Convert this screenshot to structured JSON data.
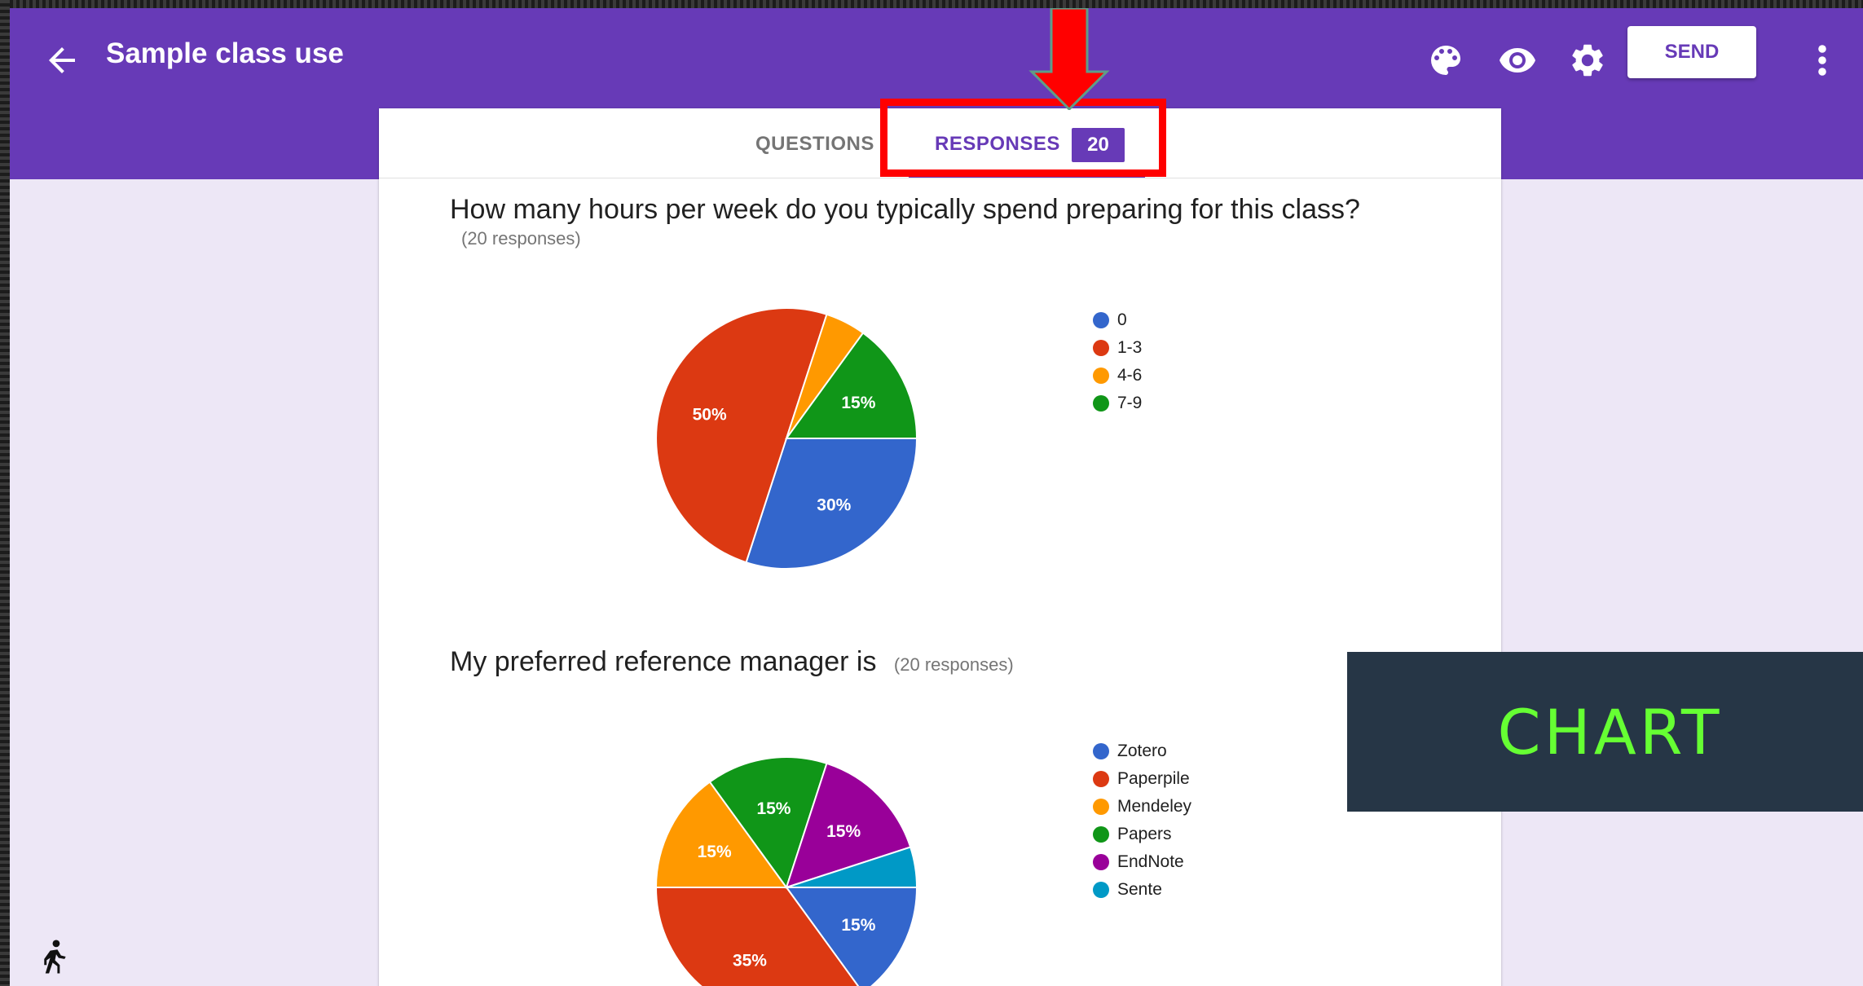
{
  "header": {
    "title": "Sample class use",
    "send_label": "SEND",
    "icons": [
      "back-arrow-icon",
      "palette-icon",
      "eye-icon",
      "gear-icon",
      "more-vert-icon"
    ],
    "color": "#673ab7"
  },
  "tabs": {
    "questions_label": "QUESTIONS",
    "responses_label": "RESPONSES",
    "responses_count": "20"
  },
  "questions": [
    {
      "title": "How many hours per week do you typically spend preparing for this class?",
      "responses": "(20 responses)"
    },
    {
      "title": "My preferred reference manager is",
      "responses": "(20 responses)"
    }
  ],
  "chart_data": [
    {
      "type": "pie",
      "categories": [
        "0",
        "1-3",
        "4-6",
        "7-9"
      ],
      "values": [
        30,
        50,
        5,
        15
      ],
      "labels": [
        "30%",
        "50%",
        "",
        "15%"
      ],
      "colors": [
        "#3366cc",
        "#dc3912",
        "#ff9900",
        "#109618"
      ],
      "legend": "right"
    },
    {
      "type": "pie",
      "categories": [
        "Zotero",
        "Paperpile",
        "Mendeley",
        "Papers",
        "EndNote",
        "Sente"
      ],
      "values": [
        15,
        35,
        15,
        15,
        15,
        5
      ],
      "labels": [
        "15%",
        "35%",
        "15%",
        "15%",
        "15%",
        ""
      ],
      "colors": [
        "#3366cc",
        "#dc3912",
        "#ff9900",
        "#109618",
        "#990099",
        "#0099c6"
      ],
      "legend": "right"
    }
  ],
  "overlay": {
    "chart_label": "CHART",
    "highlight_color": "#ff0000"
  }
}
